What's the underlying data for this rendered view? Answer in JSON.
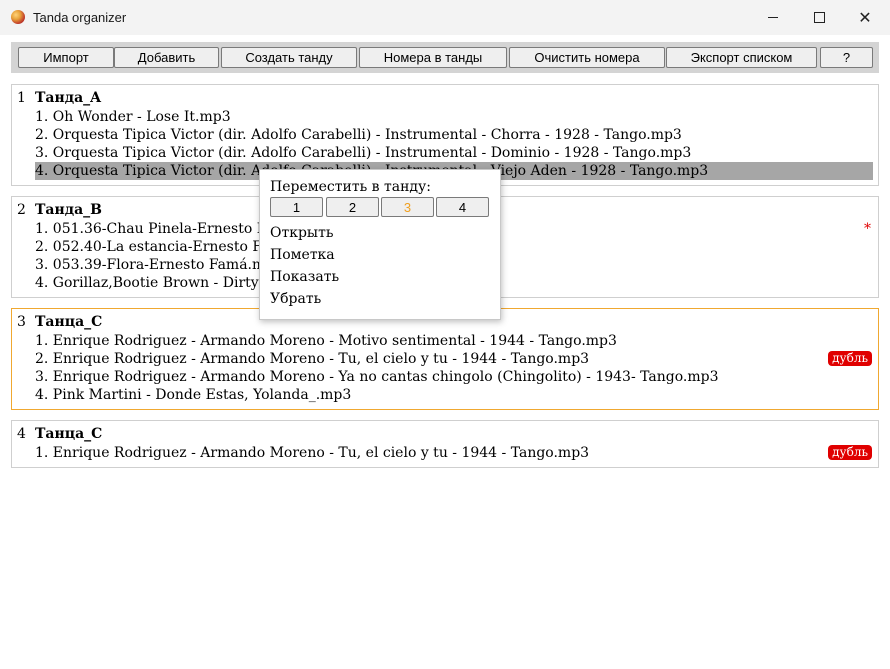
{
  "window": {
    "title": "Tanda organizer",
    "minimize": "—",
    "maximize": "☐",
    "close": "✕"
  },
  "toolbar": {
    "buttons": [
      "Импорт",
      "Добавить",
      "Создать танду",
      "Номера в танды",
      "Очистить номера",
      "Экспорт списком",
      "?"
    ]
  },
  "tandas": [
    {
      "num": "1",
      "name": "Танда_A",
      "flag": "",
      "tracks": [
        {
          "text": "1. Oh Wonder - Lose It.mp3",
          "badge": ""
        },
        {
          "text": "2. Orquesta Tipica Victor (dir. Adolfo Carabelli) - Instrumental - Chorra - 1928 - Tango.mp3",
          "badge": ""
        },
        {
          "text": "3. Orquesta Tipica Victor (dir. Adolfo Carabelli) - Instrumental - Dominio - 1928 - Tango.mp3",
          "badge": ""
        },
        {
          "text": "4. Orquesta Tipica Victor (dir. Adolfo Carabelli) - Instrumental - Viejo Aden - 1928 - Tango.mp3",
          "badge": "",
          "selected": true
        }
      ]
    },
    {
      "num": "2",
      "name": "Танда_B",
      "flag": "*",
      "tracks": [
        {
          "text": "1. 051.36-Chau Pinela-Ernesto Famá.mp3",
          "badge": ""
        },
        {
          "text": "2. 052.40-La estancia-Ernesto Famá.mp3",
          "badge": ""
        },
        {
          "text": "3. 053.39-Flora-Ernesto Famá.mp3",
          "badge": ""
        },
        {
          "text": "4. Gorillaz,Bootie Brown - Dirty Harry.mp3",
          "badge": ""
        }
      ]
    },
    {
      "num": "3",
      "name": "Танца_C",
      "flag": "",
      "active": true,
      "tracks": [
        {
          "text": "1. Enrique Rodriguez - Armando Moreno - Motivo sentimental - 1944 - Tango.mp3",
          "badge": ""
        },
        {
          "text": "2. Enrique Rodriguez - Armando Moreno - Tu, el cielo y tu - 1944 - Tango.mp3",
          "badge": "дубль"
        },
        {
          "text": "3. Enrique Rodriguez - Armando Moreno - Ya no cantas chingolo (Chingolito) - 1943- Tango.mp3",
          "badge": ""
        },
        {
          "text": "4. Pink Martini - Donde Estas, Yolanda_.mp3",
          "badge": ""
        }
      ]
    },
    {
      "num": "4",
      "name": "Танца_C",
      "flag": "",
      "tracks": [
        {
          "text": "1. Enrique Rodriguez - Armando Moreno - Tu, el cielo y tu - 1944 - Tango.mp3",
          "badge": "дубль"
        }
      ]
    }
  ],
  "context_menu": {
    "move_label": "Переместить в танду:",
    "move_targets": [
      "1",
      "2",
      "3",
      "4"
    ],
    "current_target": "3",
    "items": [
      "Открыть",
      "Пометка",
      "Показать",
      "Убрать"
    ]
  },
  "colors": {
    "accent_border": "#f0a830",
    "badge_bg": "#e00000",
    "selection_bg": "#a6a6a6",
    "current_target": "#f0a020"
  }
}
